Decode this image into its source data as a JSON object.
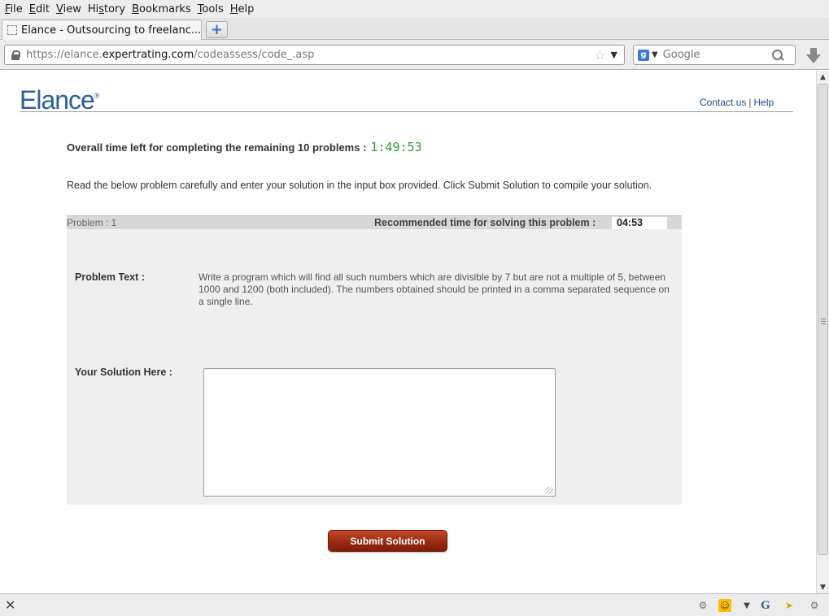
{
  "menu": {
    "items": [
      {
        "pre": "",
        "accel": "F",
        "post": "ile"
      },
      {
        "pre": "",
        "accel": "E",
        "post": "dit"
      },
      {
        "pre": "",
        "accel": "V",
        "post": "iew"
      },
      {
        "pre": "Hi",
        "accel": "s",
        "post": "tory"
      },
      {
        "pre": "",
        "accel": "B",
        "post": "ookmarks"
      },
      {
        "pre": "",
        "accel": "T",
        "post": "ools"
      },
      {
        "pre": "",
        "accel": "H",
        "post": "elp"
      }
    ]
  },
  "tab": {
    "title": "Elance - Outsourcing to freelanc..."
  },
  "newtab": {
    "glyph": "+"
  },
  "address": {
    "url_pre": "https://elance.",
    "url_host": "expertrating.com",
    "url_post": "/codeassess/code_.asp"
  },
  "search": {
    "placeholder": "Google",
    "engine_glyph": "g"
  },
  "page": {
    "logo": "Elance",
    "logo_mark": "®",
    "contact": "Contact us",
    "separator": "|",
    "help": "Help",
    "time_label": "Overall time left for completing the remaining 10 problems :",
    "time_value": "1:49:53",
    "instructions": "Read the below problem carefully and enter your solution in the input box provided. Click Submit Solution to compile your solution.",
    "problem_label": "Problem : 1",
    "recommended_label": "Recommended time for solving this problem :",
    "recommended_time": "04:53",
    "problem_text_label": "Problem Text :",
    "problem_text": "Write a program which will find all such numbers which are divisible by 7 but are not a multiple of 5, between 1000 and 1200 (both included). The numbers obtained should be printed in a comma separated sequence on a single line.",
    "solution_label": "Your Solution Here :",
    "solution_value": "",
    "submit_label": "Submit Solution"
  },
  "colors": {
    "accent": "#2d5f9e",
    "timer": "#2e9a2e",
    "button": "#9a2a12",
    "panel": "#efefef"
  },
  "icons": [
    "lock-icon",
    "bookmark-star-icon",
    "dropdown-arrow-icon",
    "google-engine-icon",
    "magnifier-icon",
    "download-arrow-icon",
    "close-icon",
    "smiley-addon-icon",
    "cursor-addon-icon"
  ]
}
